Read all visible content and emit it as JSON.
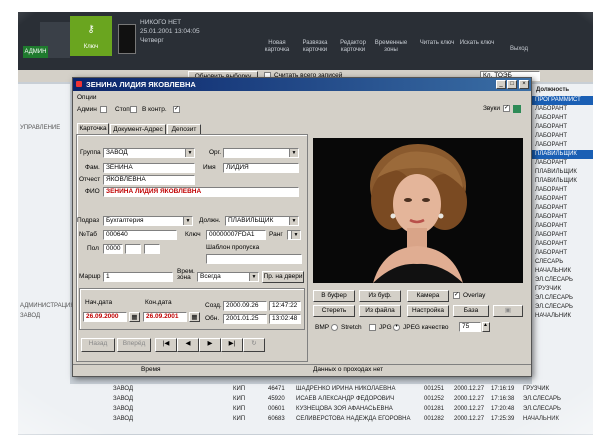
{
  "background": {
    "status_panel": {
      "line1": "НИКОГО НЕТ",
      "line2": "25.01.2001 13:04:05",
      "line3": "Четверг"
    },
    "key_label": "Ключ",
    "admin_label": "АДМИН",
    "toolbar": [
      {
        "label": "Новая карточка"
      },
      {
        "label": "Развязка карточки"
      },
      {
        "label": "Редактор карточки"
      },
      {
        "label": "Временные зоны"
      },
      {
        "label": "Читать ключ"
      },
      {
        "label": "Искать ключ"
      },
      {
        "label": "Выход"
      }
    ],
    "filter": {
      "reset": "Обновить выборку",
      "check": "Считать всего записей",
      "field": "Кл. ТОЭБ"
    },
    "left_items": [
      "УПРАВЛЕНИЕ",
      "АДМИНИСТРАЦИЯ",
      "ЗАВОД"
    ],
    "right_col_header": "Должность",
    "right_items": [
      "ПРОГРАММИСТ",
      "ЛАБОРАНТ",
      "ЛАБОРАНТ",
      "ЛАБОРАНТ",
      "ЛАБОРАНТ",
      "ЛАБОРАНТ",
      "ПЛАВИЛЬЩИК",
      "ЛАБОРАНТ",
      "ПЛАВИЛЬЩИК",
      "ПЛАВИЛЬЩИК",
      "ЛАБОРАНТ",
      "ЛАБОРАНТ",
      "ЛАБОРАНТ",
      "ЛАБОРАНТ",
      "ЛАБОРАНТ",
      "ЛАБОРАНТ",
      "ЛАБОРАНТ",
      "ЛАБОРАНТ",
      "СЛЕСАРЬ",
      "НАЧАЛЬНИК",
      "ЭЛ.СЛЕСАРЬ",
      "ГРУЗЧИК",
      "ЭЛ.СЛЕСАРЬ",
      "ЭЛ.СЛЕСАРЬ",
      "НАЧАЛЬНИК"
    ],
    "bottom_rows": [
      {
        "dept": "ЗАВОД",
        "kind": "КИП",
        "code": "46471",
        "name": "ШАДРЕНКО ИРИНА НИКОЛАЕВНА",
        "num": "001251",
        "date": "2000.12.27",
        "time": "17:16:19",
        "post": "ГРУЗЧИК"
      },
      {
        "dept": "ЗАВОД",
        "kind": "КИП",
        "code": "45920",
        "name": "ИСАЕВ АЛЕКСАНДР ФЕДОРОВИЧ",
        "num": "001252",
        "date": "2000.12.27",
        "time": "17:16:38",
        "post": "ЭЛ.СЛЕСАРЬ"
      },
      {
        "dept": "ЗАВОД",
        "kind": "КИП",
        "code": "00601",
        "name": "КУЗНЕЦОВА ЗОЯ АФАНАСЬЕВНА",
        "num": "001281",
        "date": "2000.12.27",
        "time": "17:20:48",
        "post": "ЭЛ.СЛЕСАРЬ"
      },
      {
        "dept": "ЗАВОД",
        "kind": "КИП",
        "code": "60683",
        "name": "СЕЛИВЕРСТОВА НАДЕЖДА ЕГОРОВНА",
        "num": "001282",
        "date": "2000.12.27",
        "time": "17:25:39",
        "post": "НАЧАЛЬНИК"
      }
    ]
  },
  "dialog": {
    "title": "ЗЕНИНА ЛИДИЯ ЯКОВЛЕВНА",
    "options_label": "Опции",
    "opt_admin": "Админ",
    "opt_stop": "Стоп",
    "opt_inkonr": "В контр.",
    "sound_label": "Звуки",
    "tabs": [
      "Карточка",
      "Документ-Адрес",
      "Депозит"
    ],
    "group_label": "Группа",
    "group_value": "ЗАВОД",
    "org_label": "Орг.",
    "lastname_label": "Фам.",
    "lastname_value": "ЗЕНИНА",
    "firstname_label": "Имя",
    "firstname_value": "ЛИДИЯ",
    "patronymic_label": "Отчест",
    "patronymic_value": "ЯКОВЛЕВНА",
    "fio_label": "ФИО",
    "fio_value": "ЗЕНИНА ЛИДИЯ ЯКОВЛЕВНА",
    "dept_label": "Подраз",
    "dept_value": "Бухгалтерия",
    "position_label": "Должн.",
    "position_value": "ПЛАВИЛЬЩИК",
    "tabno_label": "№Таб",
    "tabno_value": "000640",
    "key_label": "Ключ",
    "key_value": "00000007FDA1",
    "rank_label": "Ранг",
    "floor_label": "Пол",
    "floor_value": "0000",
    "template_label": "Шаблон пропуска",
    "route_label": "Маршр",
    "route_value": "1",
    "timezone_label": "Врем. зона",
    "timezone_value": "Всегда",
    "door_btn": "Пр. на двери",
    "start_label": "Нач.дата",
    "start_value": "26.09.2000",
    "end_label": "Кон.дата",
    "end_value": "26.09.2001",
    "created_label": "Созд.",
    "created_date": "2000.09.26",
    "created_time": "12:47:22",
    "updated_label": "Обн.",
    "updated_date": "2001.01.25",
    "updated_time": "13:02:48",
    "photo_buttons": {
      "to_buffer": "В буфер",
      "from_buffer": "Из буф.",
      "camera": "Камера",
      "overlay": "Overlay",
      "erase": "Стереть",
      "from_file": "Из файла",
      "settings": "Настройка",
      "base": "База"
    },
    "format": {
      "bmp": "BMP",
      "stretch": "Stretch",
      "jpg": "JPG",
      "jpeg_quality": "JPEG качество",
      "quality_value": "75"
    },
    "nav_prev_label": "Назад",
    "nav_next_label": "Вперёд",
    "status": {
      "left": "Время",
      "right": "Данных о проходах нет"
    },
    "colors": {
      "title_bar": "#0a246a",
      "fio_text": "#c00000",
      "date_text": "#c00000"
    }
  }
}
